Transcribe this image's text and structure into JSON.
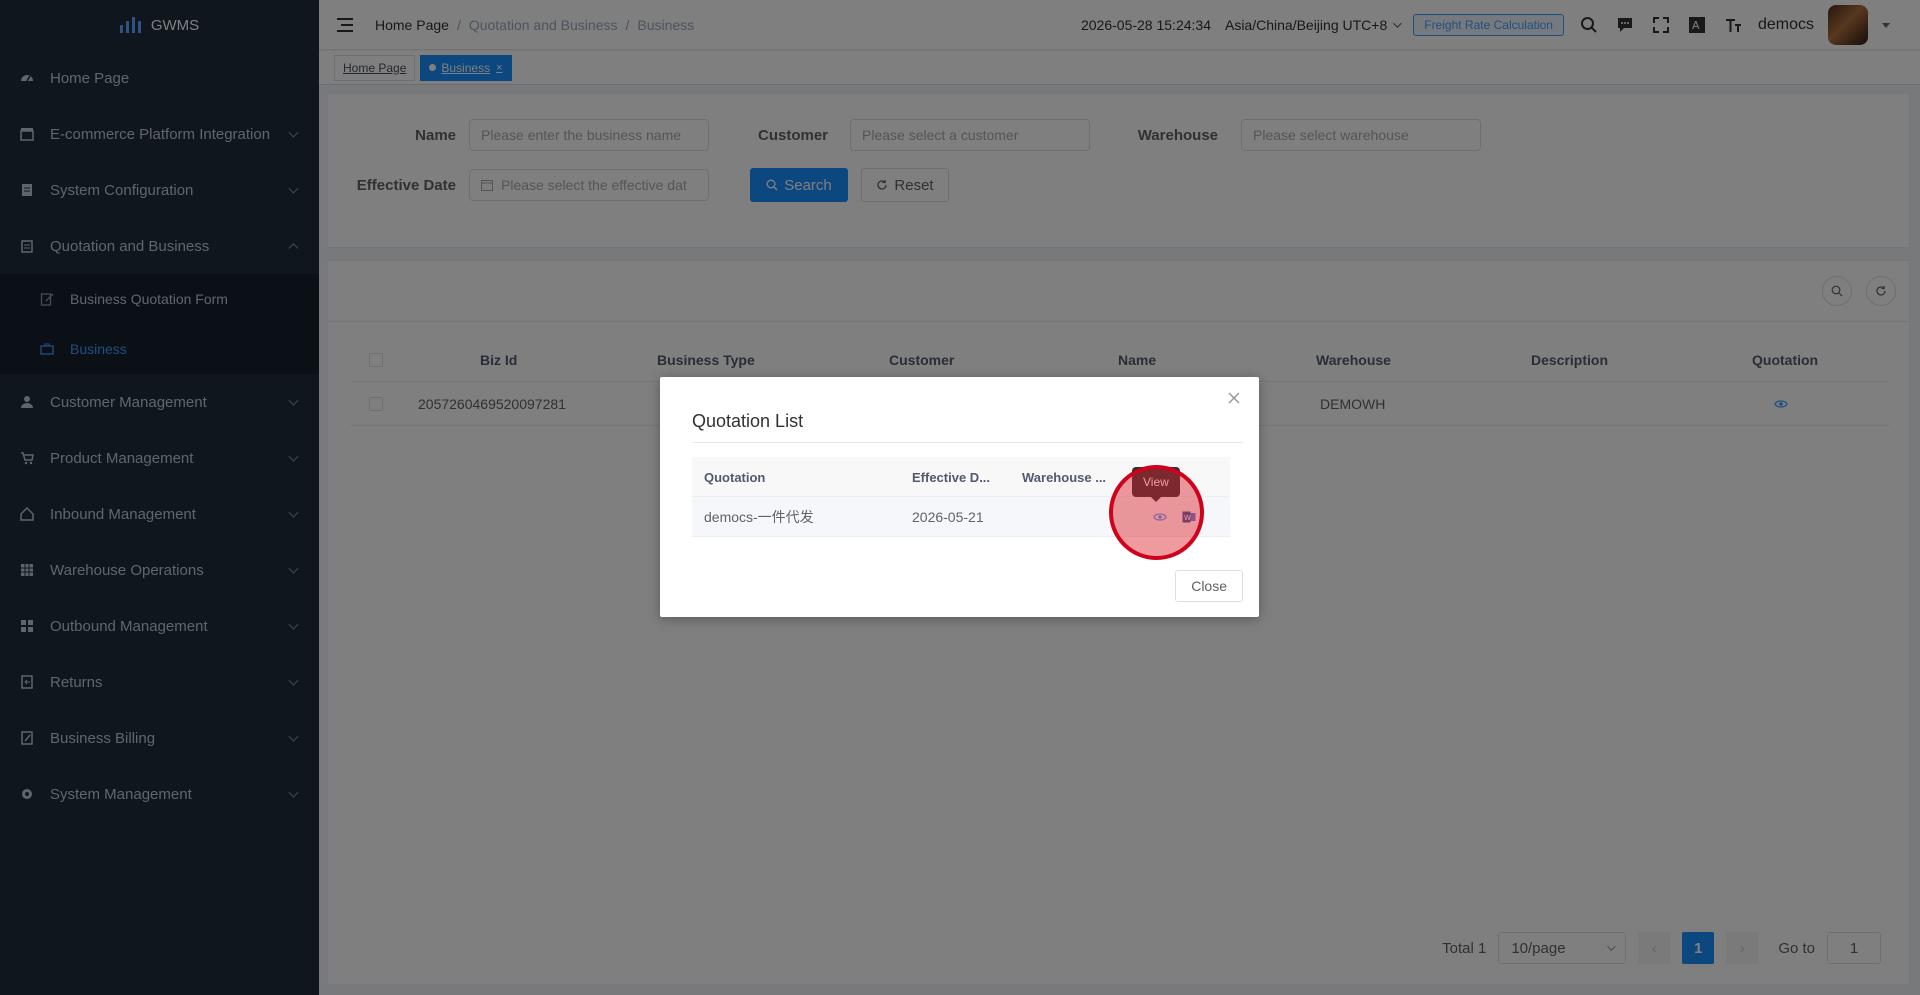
{
  "app": {
    "logo_text": "GWMS"
  },
  "sidebar": {
    "items": [
      {
        "label": "Home Page",
        "icon": "dashboard-icon",
        "expandable": false
      },
      {
        "label": "E-commerce Platform Integration",
        "icon": "store-icon",
        "expandable": true
      },
      {
        "label": "System Configuration",
        "icon": "document-icon",
        "expandable": true
      },
      {
        "label": "Quotation and Business",
        "icon": "clipboard-icon",
        "expandable": true,
        "expanded": true
      }
    ],
    "submenu": [
      {
        "label": "Business Quotation Form",
        "icon": "edit-icon",
        "active": false
      },
      {
        "label": "Business",
        "icon": "briefcase-icon",
        "active": true
      }
    ],
    "items_after": [
      {
        "label": "Customer Management",
        "icon": "user-icon"
      },
      {
        "label": "Product Management",
        "icon": "cart-icon"
      },
      {
        "label": "Inbound Management",
        "icon": "home-icon"
      },
      {
        "label": "Warehouse Operations",
        "icon": "table-icon"
      },
      {
        "label": "Outbound Management",
        "icon": "grid-icon"
      },
      {
        "label": "Returns",
        "icon": "return-icon"
      },
      {
        "label": "Business Billing",
        "icon": "billing-icon"
      },
      {
        "label": "System Management",
        "icon": "gear-icon"
      }
    ]
  },
  "header": {
    "breadcrumb": [
      "Home Page",
      "Quotation and Business",
      "Business"
    ],
    "datetime": "2026-05-28 15:24:34",
    "timezone": "Asia/China/Beijing UTC+8",
    "freight_button": "Freight Rate Calculation",
    "username": "democs"
  },
  "tags": [
    {
      "label": "Home Page",
      "active": false
    },
    {
      "label": "Business",
      "active": true
    }
  ],
  "search": {
    "name_label": "Name",
    "name_placeholder": "Please enter the business name",
    "customer_label": "Customer",
    "customer_placeholder": "Please select a customer",
    "warehouse_label": "Warehouse",
    "warehouse_placeholder": "Please select warehouse",
    "date_label": "Effective Date",
    "date_placeholder": "Please select the effective dat",
    "search_button": "Search",
    "reset_button": "Reset"
  },
  "table": {
    "columns": [
      "Biz Id",
      "Business Type",
      "Customer",
      "Name",
      "Warehouse",
      "Description",
      "Quotation"
    ],
    "rows": [
      {
        "biz_id": "2057260469520097281",
        "business_type": "",
        "customer": "",
        "name": "",
        "warehouse": "DEMOWH",
        "description": ""
      }
    ]
  },
  "pagination": {
    "total": "Total 1",
    "page_size": "10/page",
    "current_page": "1",
    "goto_label": "Go to",
    "goto_value": "1"
  },
  "modal": {
    "title": "Quotation List",
    "columns": [
      "Quotation",
      "Effective D...",
      "Warehouse ..."
    ],
    "rows": [
      {
        "quotation": "democs-一件代发",
        "effective_date": "2026-05-21",
        "warehouse": ""
      }
    ],
    "tooltip": "View",
    "close_button": "Close"
  },
  "colors": {
    "sidebar_bg": "#1f2d3d",
    "primary": "#1890ff",
    "highlight": "#d0021b"
  }
}
